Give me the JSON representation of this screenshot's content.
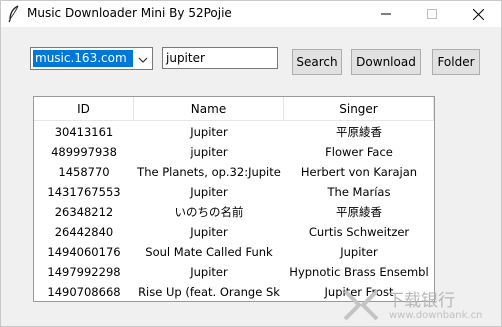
{
  "window": {
    "title": "Music Downloader Mini By 52Pojie",
    "icon": "feather-icon"
  },
  "controls": {
    "source_select": {
      "value": "music.163.com"
    },
    "search_input": {
      "value": "jupiter"
    },
    "search_button": "Search",
    "download_button": "Download",
    "folder_button": "Folder"
  },
  "results_table": {
    "columns": [
      "ID",
      "Name",
      "Singer"
    ],
    "rows": [
      {
        "id": "30413161",
        "name": "Jupiter",
        "singer": "平原綾香"
      },
      {
        "id": "489997938",
        "name": "jupiter",
        "singer": "Flower Face"
      },
      {
        "id": "1458770",
        "name": "The Planets, op.32:Jupite",
        "singer": "Herbert von Karajan"
      },
      {
        "id": "1431767553",
        "name": "Jupiter",
        "singer": "The Marías"
      },
      {
        "id": "26348212",
        "name": "いのちの名前",
        "singer": "平原綾香"
      },
      {
        "id": "26442840",
        "name": "Jupiter",
        "singer": "Curtis Schweitzer"
      },
      {
        "id": "1494060176",
        "name": "Soul Mate Called Funk",
        "singer": "Jupiter"
      },
      {
        "id": "1497992298",
        "name": "Jupiter",
        "singer": "Hypnotic Brass Ensembl"
      },
      {
        "id": "1490708668",
        "name": "Rise Up (feat. Orange Sk",
        "singer": "Jupiter Frost"
      }
    ]
  },
  "watermark": {
    "text": "下载银行",
    "url": "www.downbank.cn"
  }
}
